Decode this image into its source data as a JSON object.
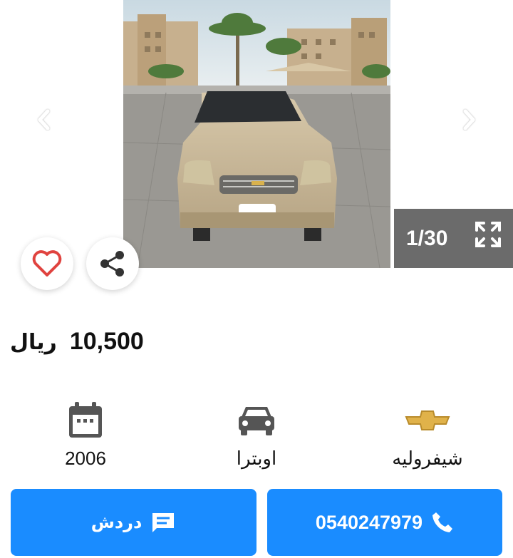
{
  "gallery": {
    "counter": "1/30",
    "prev_icon": "chevron-left-icon",
    "next_icon": "chevron-right-icon",
    "fullscreen_icon": "fullscreen-icon"
  },
  "actions": {
    "favorite_icon": "heart-icon",
    "share_icon": "share-icon"
  },
  "listing": {
    "price": "10,500",
    "currency": "ريال"
  },
  "specs": {
    "year": "2006",
    "model": "اوبترا",
    "make": "شيفروليه"
  },
  "buttons": {
    "chat_label": "دردش",
    "phone": "0540247979"
  },
  "colors": {
    "accent": "#1a8cff",
    "favorite": "#e0433f",
    "counter_bg": "#6b6b6b",
    "logo_gold": "#e0b24a"
  }
}
